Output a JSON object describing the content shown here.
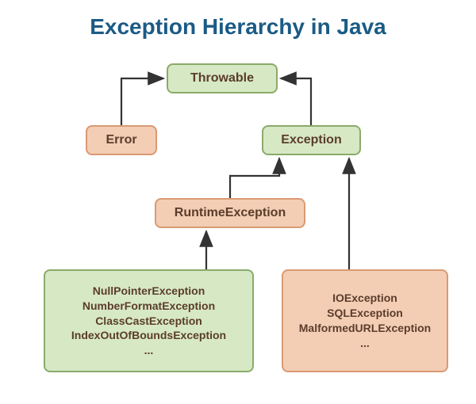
{
  "title": "Exception Hierarchy in Java",
  "nodes": {
    "throwable": "Throwable",
    "error": "Error",
    "exception": "Exception",
    "runtime": "RuntimeException",
    "runtime_children": {
      "l1": "NullPointerException",
      "l2": "NumberFormatException",
      "l3": "ClassCastException",
      "l4": "IndexOutOfBoundsException",
      "l5": "..."
    },
    "checked_children": {
      "l1": "IOException",
      "l2": "SQLException",
      "l3": "MalformedURLException",
      "l4": "..."
    }
  }
}
